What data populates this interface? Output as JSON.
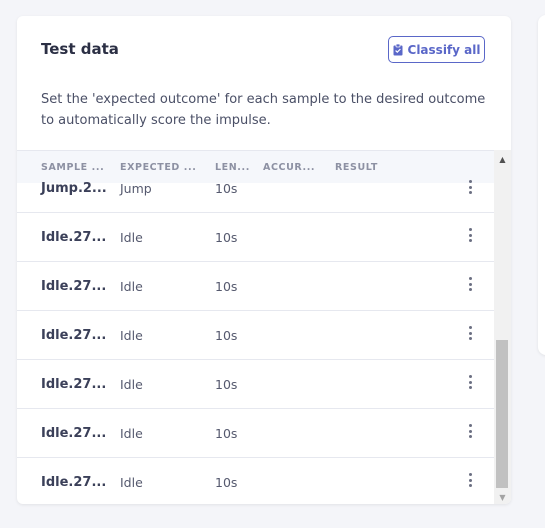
{
  "card": {
    "title": "Test data",
    "classify_button": {
      "label": "Classify all",
      "icon": "clipboard-check-icon",
      "color": "#5a67c8"
    },
    "description": "Set the 'expected outcome' for each sample to the desired outcome to automatically score the impulse."
  },
  "table": {
    "columns": [
      "SAMPLE ...",
      "EXPECTED ...",
      "LEN...",
      "ACCUR...",
      "RESULT"
    ],
    "rows": [
      {
        "name": "Jump.2...",
        "expected": "Jump",
        "length": "10s",
        "accuracy": "",
        "result": ""
      },
      {
        "name": "Idle.27...",
        "expected": "Idle",
        "length": "10s",
        "accuracy": "",
        "result": ""
      },
      {
        "name": "Idle.27...",
        "expected": "Idle",
        "length": "10s",
        "accuracy": "",
        "result": ""
      },
      {
        "name": "Idle.27...",
        "expected": "Idle",
        "length": "10s",
        "accuracy": "",
        "result": ""
      },
      {
        "name": "Idle.27...",
        "expected": "Idle",
        "length": "10s",
        "accuracy": "",
        "result": ""
      },
      {
        "name": "Idle.27...",
        "expected": "Idle",
        "length": "10s",
        "accuracy": "",
        "result": ""
      },
      {
        "name": "Idle.27...",
        "expected": "Idle",
        "length": "10s",
        "accuracy": "",
        "result": ""
      }
    ],
    "row_menu_icon": "kebab-menu-icon",
    "scroll_position": "bottom"
  }
}
